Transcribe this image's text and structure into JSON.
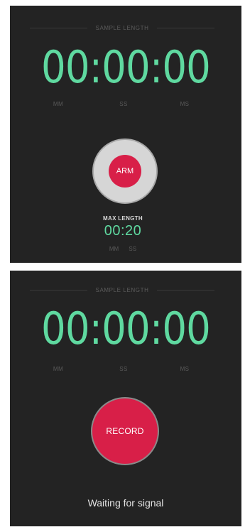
{
  "colors": {
    "background": "#232323",
    "timer": "#5fd9a0",
    "accent_red": "#d81f48",
    "muted": "#5a5a5a"
  },
  "arm_screen": {
    "header_label": "SAMPLE LENGTH",
    "timer": "00:00:00",
    "units": [
      "MM",
      "SS",
      "MS"
    ],
    "arm_label": "ARM",
    "max_length_label": "MAX LENGTH",
    "max_length_value": "00:20",
    "max_length_units": "MM SS"
  },
  "record_screen": {
    "header_label": "SAMPLE LENGTH",
    "timer": "00:00:00",
    "units": [
      "MM",
      "SS",
      "MS"
    ],
    "record_label": "RECORD",
    "status": "Waiting for signal"
  }
}
